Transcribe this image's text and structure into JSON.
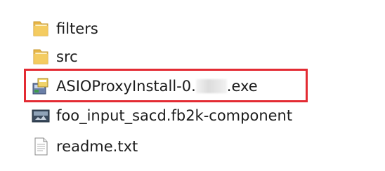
{
  "files": [
    {
      "label": "filters",
      "icon": "folder-icon"
    },
    {
      "label": "src",
      "icon": "folder-icon"
    },
    {
      "label_prefix": "ASIOProxyInstall-0.",
      "label_suffix": ".exe",
      "icon": "installer-icon"
    },
    {
      "label": "foo_input_sacd.fb2k-component",
      "icon": "component-file-icon"
    },
    {
      "label": "readme.txt",
      "icon": "text-file-icon"
    }
  ],
  "colors": {
    "highlight": "#e32b33",
    "folder": "#f2c45a"
  }
}
